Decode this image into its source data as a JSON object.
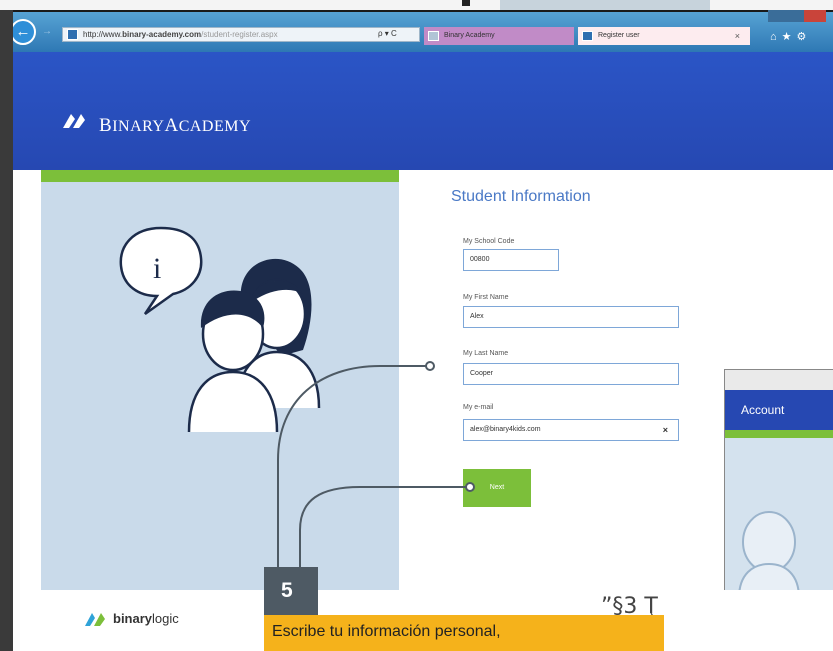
{
  "browser": {
    "url_host": "binary-academy.com",
    "url_tail": "/student-register.aspx",
    "url_prefix": "http://www.",
    "address_actions": "ρ ▾ C",
    "tabs": [
      {
        "label": "Binary Academy"
      },
      {
        "label": "Register user"
      }
    ],
    "tab_close": "×",
    "toolbar_icons": "⌂★⚙"
  },
  "header": {
    "brand_first": "B",
    "brand_first_rest": "INARY",
    "brand_second": "A",
    "brand_second_rest": "CADEMY"
  },
  "form": {
    "title": "Student Information",
    "school_code": {
      "label": "My School Code",
      "value": "00800"
    },
    "first_name": {
      "label": "My First Name",
      "value": "Alex"
    },
    "last_name": {
      "label": "My Last Name",
      "value": "Cooper"
    },
    "email": {
      "label": "My e-mail",
      "value": "alex@binary4kids.com",
      "clear": "×"
    },
    "next_label": "Next"
  },
  "illustration": {
    "speech_symbol": "i"
  },
  "second_window": {
    "header": "Account"
  },
  "footer": {
    "brand_bold": "binary",
    "brand_regular": "logic",
    "partner_text": "”§3 Ţ"
  },
  "callout": {
    "step": "5",
    "text": "Escribe tu información personal,"
  },
  "colors": {
    "header_blue": "#2648b2",
    "panel_blue": "#c9daea",
    "accent_green": "#7cbf3a",
    "title_blue": "#4a79c6",
    "callout_orange": "#f5b21b",
    "badge_gray": "#4e5a64"
  }
}
